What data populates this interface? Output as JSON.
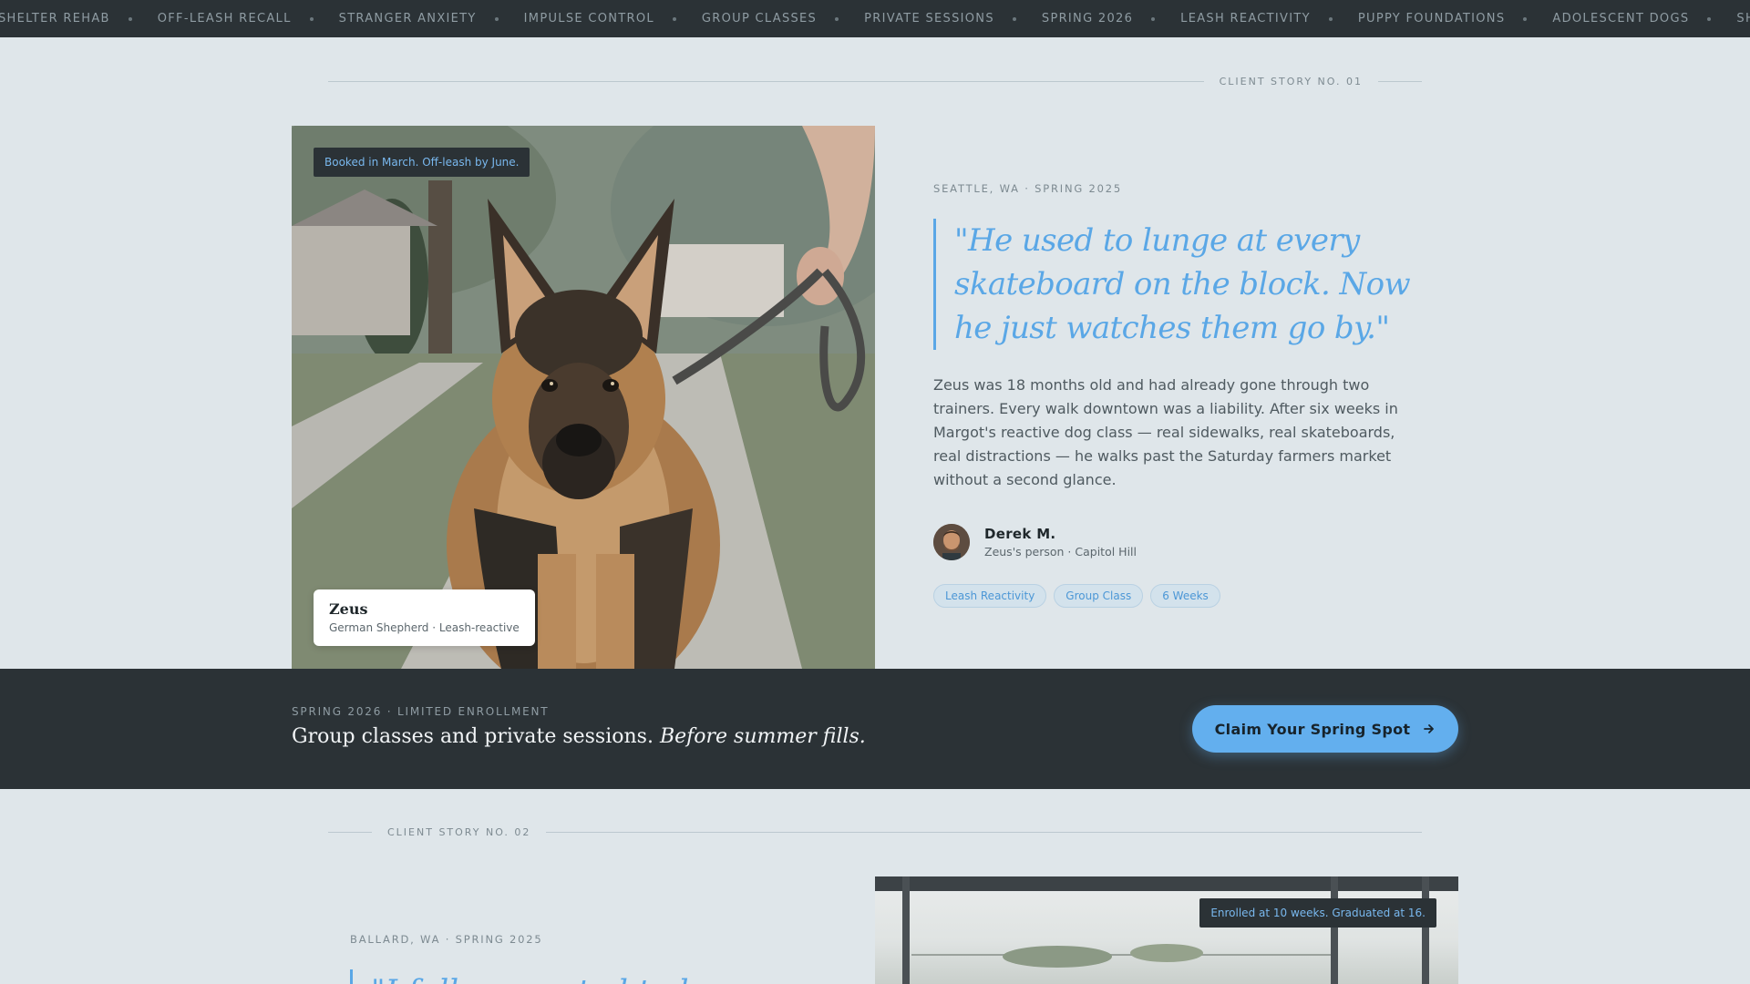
{
  "ticker": {
    "items": [
      "SHELTER REHAB",
      "OFF-LEASH RECALL",
      "STRANGER ANXIETY",
      "IMPULSE CONTROL",
      "GROUP CLASSES",
      "PRIVATE SESSIONS",
      "SPRING 2026",
      "LEASH REACTIVITY",
      "PUPPY FOUNDATIONS",
      "ADOLESCENT DOGS",
      "SHELTER REHAB"
    ]
  },
  "story1": {
    "header": "CLIENT STORY NO. 01",
    "photo_badge": "Booked in March. Off-leash by June.",
    "pet_name": "Zeus",
    "pet_meta": "German Shepherd · Leash-reactive",
    "location": "SEATTLE, WA · SPRING 2025",
    "quote": "\"He used to lunge at every skateboard on the block. Now he just watches them go by.\"",
    "body": "Zeus was 18 months old and had already gone through two trainers. Every walk downtown was a liability. After six weeks in Margot's reactive dog class — real sidewalks, real skateboards, real distractions — he walks past the Saturday farmers market without a second glance.",
    "author_name": "Derek M.",
    "author_meta": "Zeus's person · Capitol Hill",
    "tags": [
      "Leash Reactivity",
      "Group Class",
      "6 Weeks"
    ]
  },
  "cta": {
    "eyebrow": "SPRING 2026 · LIMITED ENROLLMENT",
    "headline_regular": "Group classes and private sessions. ",
    "headline_italic": "Before summer fills.",
    "button_label": "Claim Your Spring Spot",
    "button_icon": "arrow-right-icon"
  },
  "story2": {
    "header": "CLIENT STORY NO. 02",
    "location": "BALLARD, WA · SPRING 2025",
    "quote": "\"I fully expected to be a certain",
    "photo_badge": "Enrolled at 10 weeks. Graduated at 16."
  },
  "colors": {
    "accent": "#5aa7e6",
    "dark": "#2b3236",
    "background": "#dfe6ea"
  }
}
